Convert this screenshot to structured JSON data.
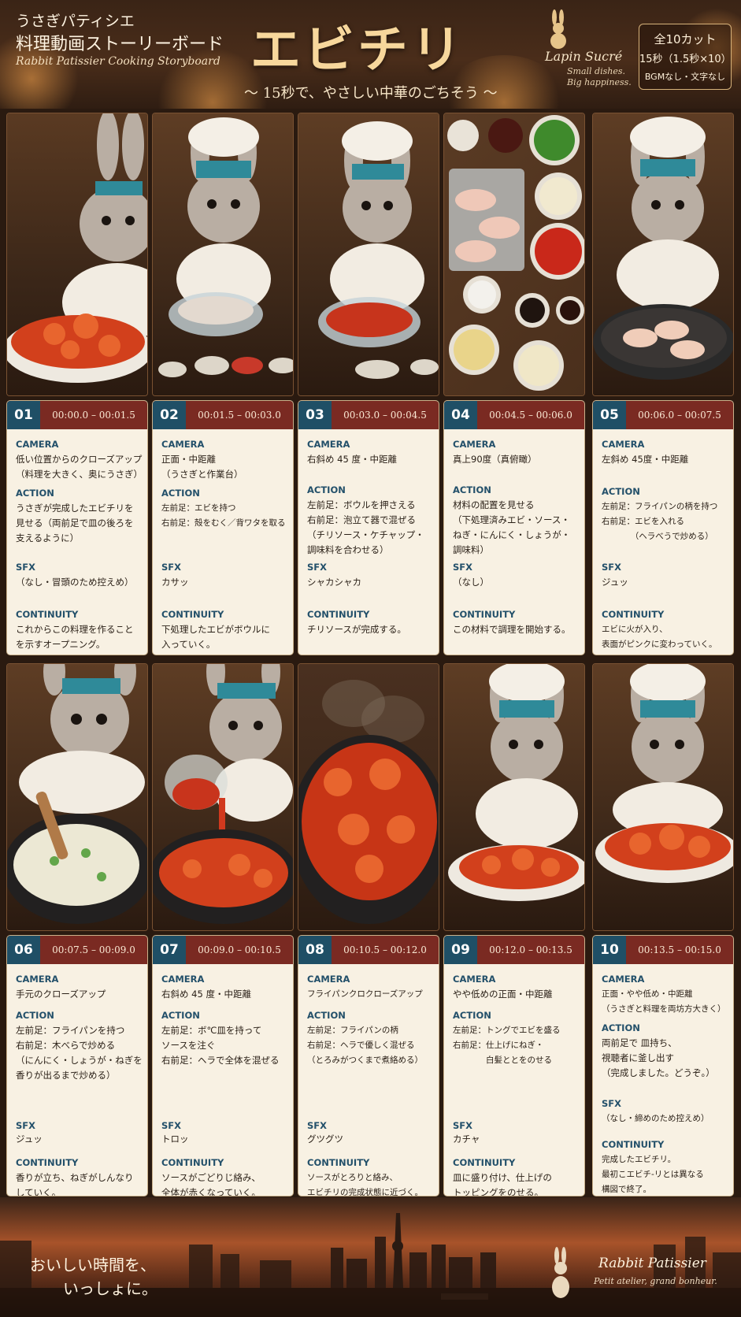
{
  "header": {
    "brand_line1": "うさぎパティシエ",
    "brand_line2": "料理動画ストーリーボード",
    "brand_en": "Rabbit Patissier  Cooking Storyboard",
    "title": "エビチリ",
    "subtitle": "～ 15秒で、やさしい中華のごちそう ～",
    "logo_name": "Lapin Sucré",
    "logo_tag1": "Small dishes.",
    "logo_tag2": "Big happiness.",
    "info_cuts": "全10カット",
    "info_duration": "15秒（1.5秒×10）",
    "info_note": "BGMなし・文字なし"
  },
  "labels": {
    "camera": "CAMERA",
    "action": "ACTION",
    "sfx": "SFX",
    "continuity": "CONTINUITY"
  },
  "cuts": [
    {
      "num": "01",
      "time": "00:00.0 – 00:01.5",
      "camera": "低い位置からのクローズアップ\n（料理を大きく、奥にうさぎ）",
      "action": "うさぎが完成したエビチリを\n見せる（両前足で皿の後ろを\n支えるように）",
      "sfx": "（なし・冒頭のため控えめ）",
      "continuity": "これからこの料理を作ること\nを示すオープニング。"
    },
    {
      "num": "02",
      "time": "00:01.5 – 00:03.0",
      "camera": "正面・中距離\n（うさぎと作業台）",
      "action": "左前足：エビを持つ\n右前足：殻をむく／背ワタを取る",
      "sfx": "カサッ",
      "continuity": "下処理したエビがボウルに\n入っていく。"
    },
    {
      "num": "03",
      "time": "00:03.0 – 00:04.5",
      "camera": "右斜め 45 度・中距離",
      "action": "左前足：ボウルを押さえる\n右前足：泡立て器で混ぜる\n（チリソース・ケチャップ・\n調味料を合わせる）",
      "sfx": "シャカシャカ",
      "continuity": "チリソースが完成する。"
    },
    {
      "num": "04",
      "time": "00:04.5 – 00:06.0",
      "camera": "真上90度（真俯瞰）",
      "action": "材料の配置を見せる\n（下処理済みエビ・ソース・\nねぎ・にんにく・しょうが・\n調味料）",
      "sfx": "（なし）",
      "continuity": "この材料で調理を開始する。"
    },
    {
      "num": "05",
      "time": "00:06.0 – 00:07.5",
      "camera": "左斜め 45度・中距離",
      "action": "左前足：フライパンの柄を持つ\n右前足：エビを入れる\n　　　　（ヘラべうで炒める）",
      "sfx": "ジュッ",
      "continuity": "エビに火が入り、\n表面がピンクに変わっていく。"
    },
    {
      "num": "06",
      "time": "00:07.5 – 00:09.0",
      "camera": "手元のクローズアップ",
      "action": "左前足：フライパンを持つ\n右前足：木べらで炒める\n（にんにく・しょうが・ねぎを\n香りが出るまで炒める）",
      "sfx": "ジュッ",
      "continuity": "香りが立ち、ねぎがしんなり\nしていく。"
    },
    {
      "num": "07",
      "time": "00:09.0 – 00:10.5",
      "camera": "右斜め 45 度・中距離",
      "action": "左前足：ボ℃皿を持って\nソースを注ぐ\n右前足：ヘラで全体を混ぜる",
      "sfx": "トロッ",
      "continuity": "ソースがごどりじ絡み、\n全体が赤くなっていく。"
    },
    {
      "num": "08",
      "time": "00:10.5 – 00:12.0",
      "camera": "フライパンクロクローズアップ",
      "action": "左前足：フライパンの柄\n右前足：ヘラで優しく混ぜる\n（とろみがつくまで煮絡める）",
      "sfx": "グツグツ",
      "continuity": "ソースがとろりと絡み、\nエビチリの完成状態に近づく。"
    },
    {
      "num": "09",
      "time": "00:12.0 – 00:13.5",
      "camera": "やや低めの正面・中距離",
      "action": "左前足：トングでエビを盛る\n右前足：仕上げにねぎ・\n　　　　白髪ととをのせる",
      "sfx": "カチャ",
      "continuity": "皿に盛り付け、仕上げの\nトッピングをのせる。"
    },
    {
      "num": "10",
      "time": "00:13.5 – 00:15.0",
      "camera": "正面・やや低め・中距離\n（うさぎと料理を両坊方大きく）",
      "action": "両前足で 皿持ち、\n視聴者に釜し出す\n（完成しました。どうぞ。）",
      "sfx": "（なし・締めのため控えめ）",
      "continuity": "完成したエビチリ。\n最初こエビチ-リとは異なる\n構図で終了。"
    }
  ],
  "footer": {
    "line1": "おいしい時間を、",
    "line2": "いっしょに。",
    "brand": "Rabbit Patissier",
    "tagline": "Petit atelier, grand bonheur."
  },
  "colors": {
    "header_bg": "#3a2416",
    "title": "#f7d79c",
    "card_bg": "#f8f1e3",
    "num_bg": "#1f4f66",
    "time_bg": "#7a2a22",
    "label": "#23506a"
  }
}
